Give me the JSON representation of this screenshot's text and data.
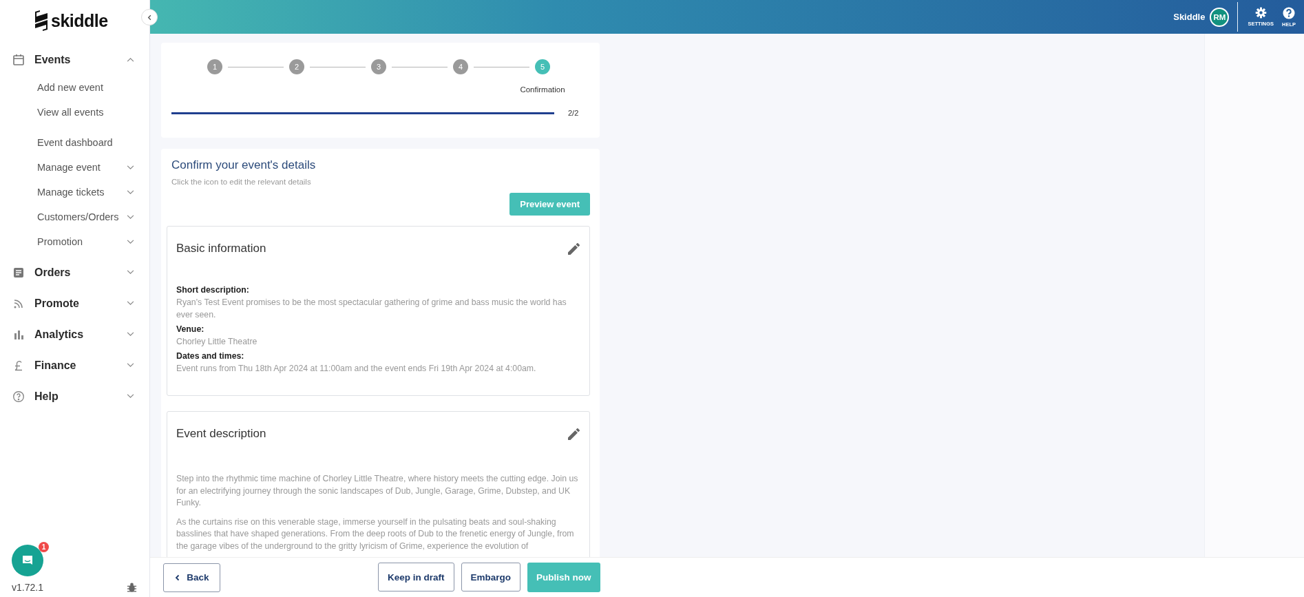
{
  "sidebar": {
    "logo": "skiddle",
    "nav": [
      {
        "label": "Events",
        "expanded": true,
        "groups": [
          {
            "items": [
              {
                "label": "Add new event",
                "kind": "link"
              },
              {
                "label": "View all events",
                "kind": "link"
              }
            ]
          },
          {
            "items": [
              {
                "label": "Event dashboard",
                "kind": "link"
              },
              {
                "label": "Manage event",
                "kind": "menu",
                "expanded": false
              },
              {
                "label": "Manage tickets",
                "kind": "menu",
                "expanded": false
              },
              {
                "label": "Customers/Orders",
                "kind": "menu",
                "expanded": false
              },
              {
                "label": "Promotion",
                "kind": "menu",
                "expanded": false
              }
            ]
          }
        ]
      },
      {
        "label": "Orders",
        "expanded": false
      },
      {
        "label": "Promote",
        "expanded": false
      },
      {
        "label": "Analytics",
        "expanded": false
      },
      {
        "label": "Finance",
        "expanded": false
      },
      {
        "label": "Help",
        "expanded": false
      }
    ],
    "chat_badge": "1",
    "version": "v1.72.1"
  },
  "header": {
    "user_name": "Skiddle",
    "avatar_initials": "RM",
    "actions": [
      {
        "label": "SETTINGS",
        "kind": "settings"
      },
      {
        "label": "HELP",
        "kind": "help"
      }
    ]
  },
  "stepper": {
    "steps": [
      {
        "number": "1",
        "selected": false
      },
      {
        "number": "2",
        "selected": false
      },
      {
        "number": "3",
        "selected": false
      },
      {
        "number": "4",
        "selected": false
      },
      {
        "number": "5",
        "selected": true,
        "label": "Confirmation"
      }
    ],
    "progress": {
      "level": 1,
      "reading": "2/2"
    }
  },
  "confirm": {
    "title": "Confirm your event's details",
    "subtitle": "Click the icon to edit the relevant details",
    "preview_button": "Preview event",
    "sections": [
      {
        "title": "Basic information",
        "kind": "fields",
        "fields": [
          {
            "label": "Short description:",
            "value": "Ryan's Test Event promises to be the most spectacular gathering of grime and bass music the world has ever seen."
          },
          {
            "label": "Venue:",
            "value": "Chorley Little Theatre"
          },
          {
            "label": "Dates and times:",
            "value": "Event runs from Thu 18th Apr 2024 at 11:00am and the event ends Fri 19th Apr 2024 at 4:00am."
          }
        ]
      },
      {
        "title": "Event description",
        "kind": "text",
        "paragraphs": [
          "Step into the rhythmic time machine of Chorley Little Theatre, where history meets the cutting edge. Join us for an electrifying journey through the sonic landscapes of Dub, Jungle, Garage, Grime, Dubstep, and UK Funky.",
          "As the curtains rise on this venerable stage, immerse yourself in the pulsating beats and soul-shaking basslines that have shaped generations. From the deep roots of Dub to the frenetic energy of Jungle, from the garage vibes of the underground to the gritty lyricism of Grime, experience the evolution of"
        ]
      }
    ]
  },
  "footer": {
    "buttons": [
      {
        "label": "Back",
        "kind": "back"
      },
      {
        "label": "Keep in draft",
        "kind": "outline"
      },
      {
        "label": "Embargo",
        "kind": "outline"
      },
      {
        "label": "Publish now",
        "kind": "primary"
      }
    ]
  }
}
